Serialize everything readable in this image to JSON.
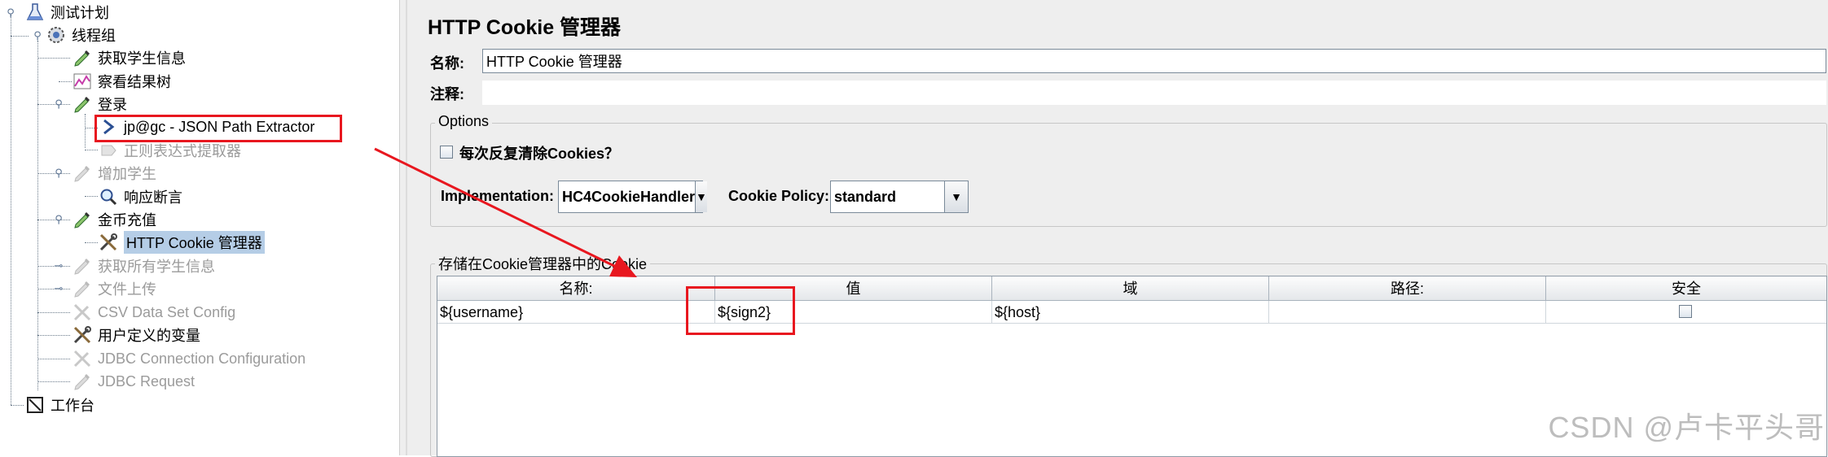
{
  "tree": {
    "items": [
      {
        "label": "测试计划",
        "icon": "flask-icon"
      },
      {
        "label": "线程组",
        "icon": "gear-icon"
      },
      {
        "label": "获取学生信息",
        "icon": "pipette-icon"
      },
      {
        "label": "察看结果树",
        "icon": "graph-icon"
      },
      {
        "label": "登录",
        "icon": "pipette-icon"
      },
      {
        "label": "jp@gc - JSON Path Extractor",
        "icon": "arrow-extractor-icon"
      },
      {
        "label": "正则表达式提取器",
        "icon": "extractor-icon"
      },
      {
        "label": "增加学生",
        "icon": "pipette-icon"
      },
      {
        "label": "响应断言",
        "icon": "magnifier-icon"
      },
      {
        "label": "金币充值",
        "icon": "pipette-icon"
      },
      {
        "label": "HTTP Cookie 管理器",
        "icon": "tools-icon"
      },
      {
        "label": "获取所有学生信息",
        "icon": "pipette-icon"
      },
      {
        "label": "文件上传",
        "icon": "pipette-icon"
      },
      {
        "label": "CSV Data Set Config",
        "icon": "tools-icon"
      },
      {
        "label": "用户定义的变量",
        "icon": "tools-icon"
      },
      {
        "label": "JDBC Connection Configuration",
        "icon": "tools-icon"
      },
      {
        "label": "JDBC Request",
        "icon": "pipette-icon"
      },
      {
        "label": "工作台",
        "icon": "workbench-icon"
      }
    ]
  },
  "panel": {
    "title": "HTTP Cookie 管理器",
    "name_label": "名称:",
    "name_value": "HTTP Cookie 管理器",
    "comment_label": "注释:",
    "comment_value": "",
    "options_legend": "Options",
    "clear_each_iteration_label": "每次反复清除Cookies？",
    "clear_each_iteration_checked": false,
    "implementation_label": "Implementation:",
    "implementation_value": "HC4CookieHandler",
    "policy_label": "Cookie Policy:",
    "policy_value": "standard",
    "stored_legend": "存储在Cookie管理器中的Cookie",
    "table": {
      "columns": [
        "名称:",
        "值",
        "域",
        "路径:",
        "安全"
      ],
      "rows": [
        {
          "name": "${username}",
          "value": "${sign2}",
          "domain": "${host}",
          "path": "",
          "secure": false
        }
      ]
    }
  },
  "watermark": "CSDN @卢卡平头哥",
  "colors": {
    "annotation": "#e8171f",
    "selection": "#b5cde6",
    "panel_bg": "#eeeeee"
  }
}
